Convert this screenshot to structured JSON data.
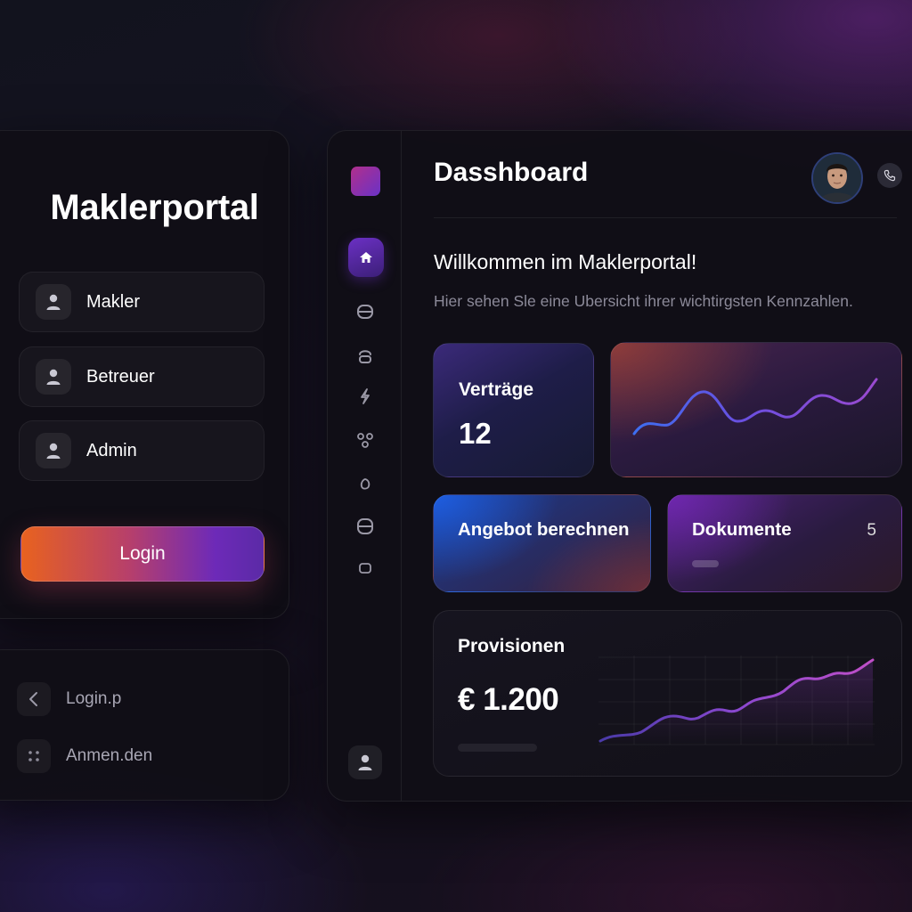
{
  "login": {
    "title": "Maklerportal",
    "roles": [
      {
        "label": "Makler",
        "icon": "user-icon"
      },
      {
        "label": "Betreuer",
        "icon": "user-icon"
      },
      {
        "label": "Admin",
        "icon": "user-icon"
      }
    ],
    "login_button": "Login"
  },
  "nav_links": [
    {
      "label": "Login.p",
      "icon": "chevron-left-icon"
    },
    {
      "label": "Anmen.den",
      "icon": "grid-dots-icon"
    }
  ],
  "sidebar": {
    "icons": [
      "home-icon",
      "card-icon",
      "shield-icon",
      "bolt-icon",
      "network-icon",
      "drop-icon",
      "document-icon",
      "square-icon",
      "user-icon"
    ]
  },
  "dashboard": {
    "title": "Dasshboard",
    "welcome": "Willkommen im Maklerportal!",
    "subtitle": "Hier sehen Sle eine Ubersicht ihrer wichtirgsten Kennzahlen.",
    "tiles": {
      "vertraege": {
        "label": "Verträge",
        "value": "12"
      },
      "angebot": {
        "label": "Angebot berechnen"
      },
      "dokumente": {
        "label": "Dokumente",
        "count": "5"
      },
      "provisionen": {
        "label": "Provisionen",
        "value": "€ 1.200"
      }
    }
  },
  "colors": {
    "accent_purple": "#6b30c4",
    "accent_orange": "#e8621f",
    "accent_blue": "#3a6cf0",
    "background": "#14121d"
  }
}
